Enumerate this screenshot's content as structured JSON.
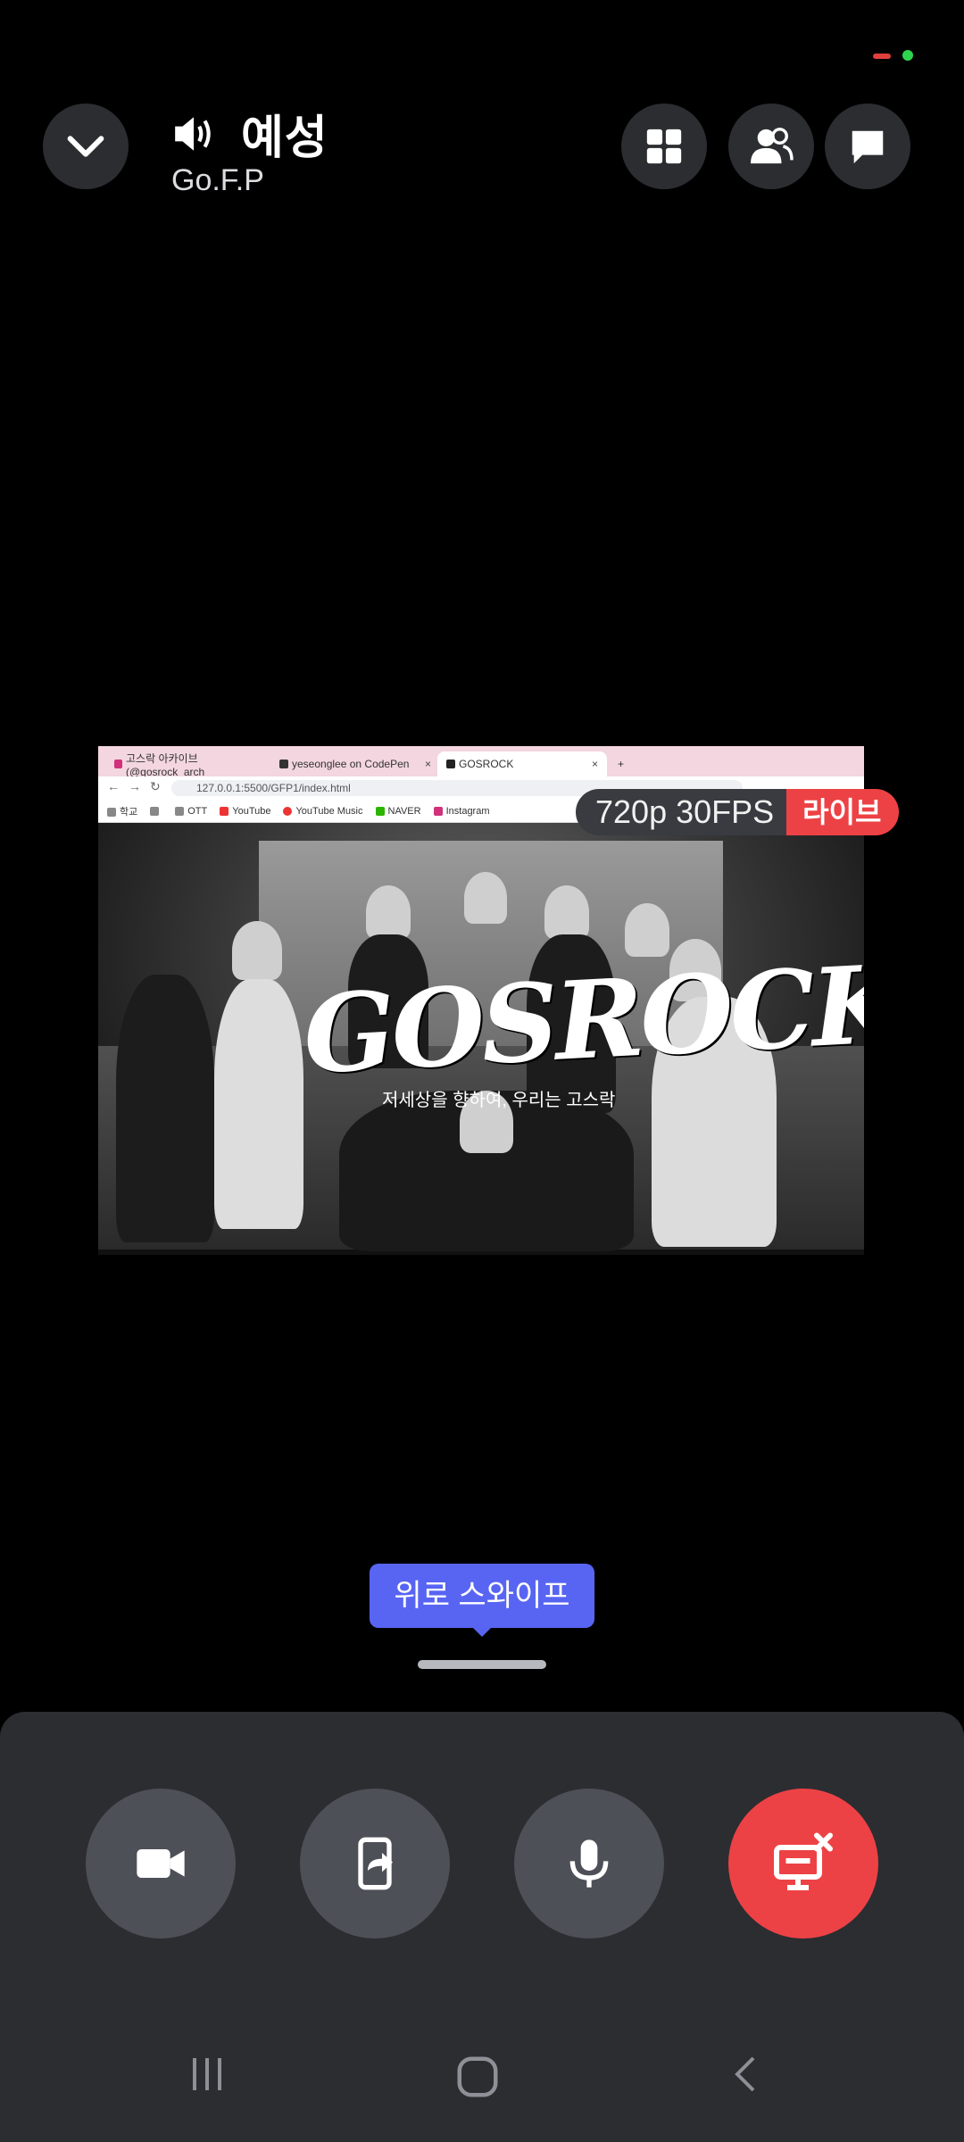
{
  "status": {
    "colors": {
      "red": "#e0403b",
      "green": "#2ed34d"
    }
  },
  "header": {
    "channel_name": "예성",
    "server_name": "Go.F.P",
    "icons": [
      "chevron-down-icon",
      "speaker-icon",
      "grid-layout-icon",
      "members-icon",
      "chat-icon"
    ]
  },
  "stream": {
    "browser": {
      "tabs": [
        "고스락 아카이브(@gosrock_arch",
        "yeseonglee on CodePen",
        "GOSROCK"
      ],
      "new_tab": "+",
      "address": "127.0.0.1:5500/GFP1/index.html",
      "bookmarks": [
        "학교",
        "",
        "OTT",
        "YouTube",
        "YouTube Music",
        "NAVER",
        "Instagram"
      ]
    },
    "logo": "GOSROCK",
    "logo_sub": "저세상을 향하여, 우리는 고스락",
    "quality": "720p 30FPS",
    "live": "라이브"
  },
  "hint": {
    "swipe": "위로 스와이프"
  },
  "controls": {
    "camera": "camera-icon",
    "screenshare": "screen-share-icon",
    "mic": "microphone-icon",
    "end": "stop-stream-icon",
    "colors": {
      "button": "#4e5058",
      "end": "#ed4245",
      "accent": "#5865f2"
    }
  },
  "navbar": {
    "icons": [
      "recent-apps-icon",
      "home-icon",
      "back-icon"
    ]
  }
}
